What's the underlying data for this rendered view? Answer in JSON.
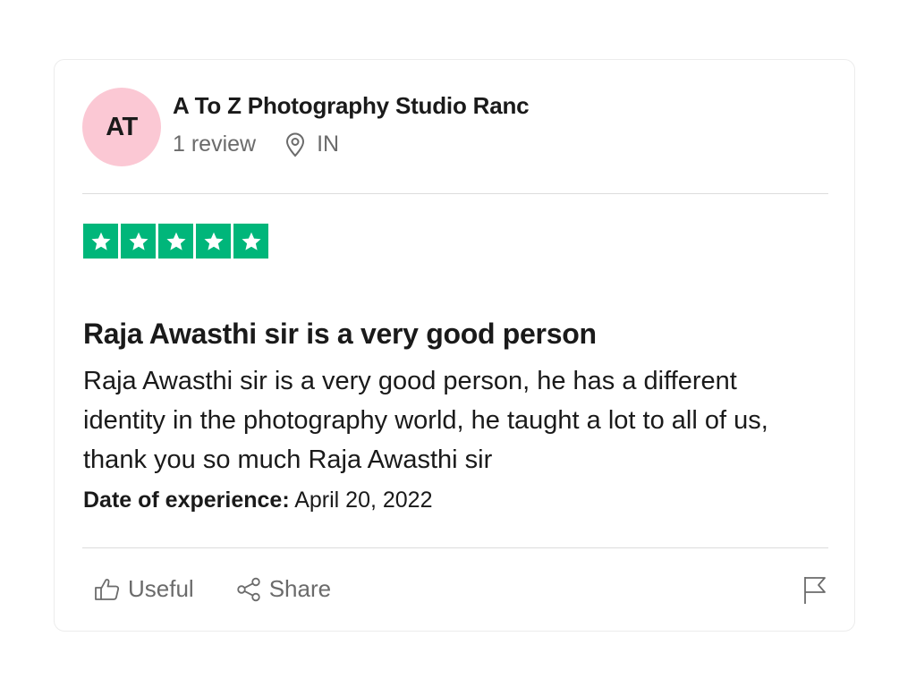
{
  "reviewer": {
    "initials": "AT",
    "name": "A To Z Photography Studio Ranc",
    "review_count": "1 review",
    "country": "IN",
    "avatar_color": "#fbc8d4"
  },
  "rating": {
    "stars": 5,
    "max": 5,
    "color": "#00b67a",
    "icon": "star-icon"
  },
  "review": {
    "title": "Raja Awasthi sir is a very good person",
    "body": "Raja Awasthi sir is a very good person, he has a different identity in the photography world, he taught a lot to all of us, thank you so much Raja Awasthi sir",
    "experience_label": "Date of experience:",
    "experience_date": "April 20, 2022"
  },
  "actions": {
    "useful_label": "Useful",
    "share_label": "Share",
    "useful_icon": "thumbs-up-icon",
    "share_icon": "share-icon",
    "report_icon": "flag-icon"
  }
}
